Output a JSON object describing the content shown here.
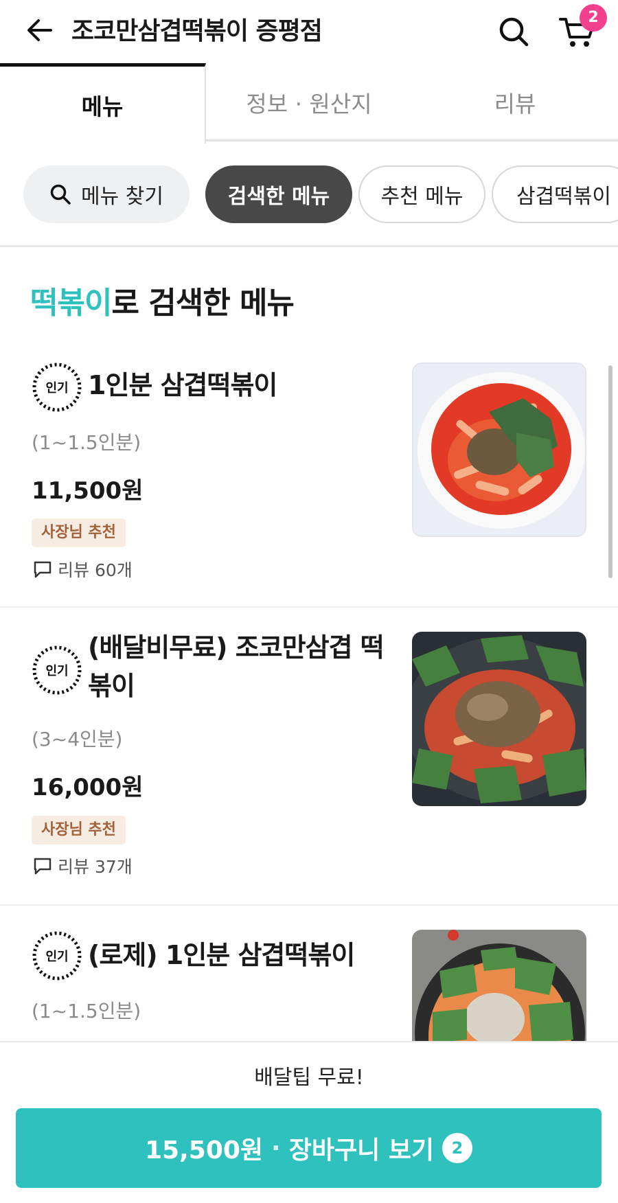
{
  "header": {
    "title": "조코만삼겹떡볶이 증평점",
    "cart_count": "2"
  },
  "tabs": [
    {
      "label": "메뉴"
    },
    {
      "label": "정보 · 원산지"
    },
    {
      "label": "리뷰"
    }
  ],
  "chips": {
    "search": "메뉴 찾기",
    "active": "검색한 메뉴",
    "c2": "추천 메뉴",
    "c3": "삼겹떡볶이"
  },
  "section": {
    "keyword": "떡볶이",
    "suffix": "로 검색한 메뉴"
  },
  "items": [
    {
      "badge": "인기",
      "name": "1인분 삼겹떡볶이",
      "serving": "(1~1.5인분)",
      "price": "11,500원",
      "tag": "사장님 추천",
      "reviews": "리뷰 60개"
    },
    {
      "badge": "인기",
      "name": "(배달비무료) 조코만삼겹 떡볶이",
      "serving": "(3~4인분)",
      "price": "16,000원",
      "tag": "사장님 추천",
      "reviews": "리뷰 37개"
    },
    {
      "badge": "인기",
      "name": "(로제) 1인분 삼겹떡볶이",
      "serving": "(1~1.5인분)"
    }
  ],
  "bottom": {
    "tip": "배달팁 무료!",
    "total": "15,500원",
    "cart_label": "장바구니 보기",
    "cart_count": "2"
  },
  "colors": {
    "accent": "#2fc1bd",
    "badge": "#f23f8e",
    "tag_bg": "#f7ece2",
    "tag_text": "#a0623a"
  }
}
